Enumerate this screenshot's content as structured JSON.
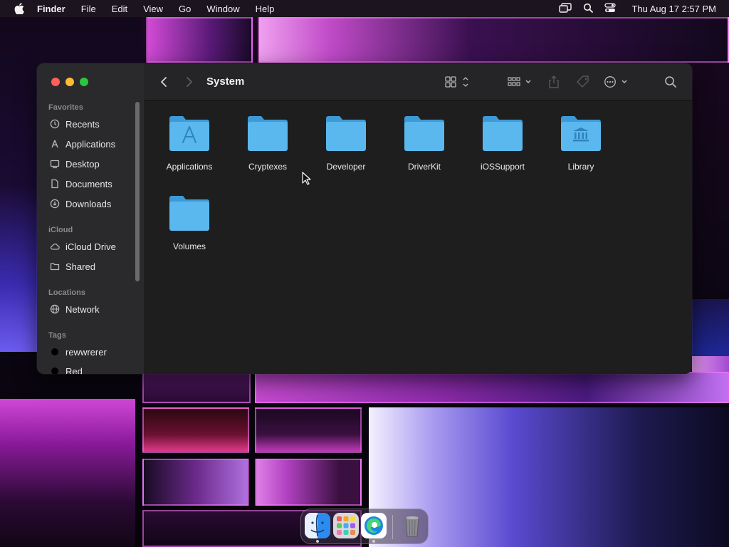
{
  "menubar": {
    "app_name": "Finder",
    "menus": [
      "File",
      "Edit",
      "View",
      "Go",
      "Window",
      "Help"
    ],
    "clock": "Thu Aug 17  2:57 PM",
    "status_icons": [
      "screen-mirroring-icon",
      "spotlight-search-icon",
      "control-center-icon"
    ]
  },
  "window": {
    "title": "System",
    "sidebar": {
      "favorites_header": "Favorites",
      "favorites": [
        {
          "label": "Recents",
          "icon": "clock-icon"
        },
        {
          "label": "Applications",
          "icon": "applications-icon"
        },
        {
          "label": "Desktop",
          "icon": "desktop-icon"
        },
        {
          "label": "Documents",
          "icon": "document-icon"
        },
        {
          "label": "Downloads",
          "icon": "download-icon"
        }
      ],
      "icloud_header": "iCloud",
      "icloud": [
        {
          "label": "iCloud Drive",
          "icon": "cloud-icon"
        },
        {
          "label": "Shared",
          "icon": "shared-folder-icon"
        }
      ],
      "locations_header": "Locations",
      "locations": [
        {
          "label": "Network",
          "icon": "globe-icon"
        }
      ],
      "tags_header": "Tags",
      "tags": [
        {
          "label": "rewwrerer",
          "color": "#000000"
        },
        {
          "label": "Red",
          "color": "#000000"
        }
      ]
    },
    "folders": [
      {
        "label": "Applications",
        "badge": "applications"
      },
      {
        "label": "Cryptexes",
        "badge": ""
      },
      {
        "label": "Developer",
        "badge": ""
      },
      {
        "label": "DriverKit",
        "badge": ""
      },
      {
        "label": "iOSSupport",
        "badge": ""
      },
      {
        "label": "Library",
        "badge": "library"
      },
      {
        "label": "Volumes",
        "badge": ""
      }
    ]
  },
  "dock": {
    "apps": [
      "Finder",
      "Launchpad",
      "Microsoft Edge",
      "Trash"
    ]
  },
  "colors": {
    "folder": "#5ab8ee",
    "folder_dark": "#3e9ad6",
    "window_bg": "#1e1e1e",
    "sidebar_bg": "#2a2a2c"
  }
}
